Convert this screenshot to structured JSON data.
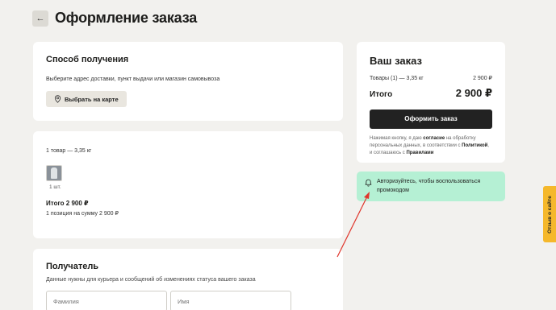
{
  "header": {
    "back_icon": "arrow-left",
    "title": "Оформление заказа"
  },
  "delivery": {
    "title": "Способ получения",
    "description": "Выберите адрес доставки, пункт выдачи или магазин самовывоза",
    "map_button": "Выбрать на карте"
  },
  "items": {
    "count_weight": "1 товар — 3,35 кг",
    "qty": "1 шт.",
    "total": "Итого 2 900 ₽",
    "summary": "1 позиция на сумму 2 900 ₽"
  },
  "recipient": {
    "title": "Получатель",
    "description": "Данные нужны для курьера и сообщений об изменениях статуса вашего заказа",
    "last_name_placeholder": "Фамилия",
    "first_name_placeholder": "Имя"
  },
  "order": {
    "title": "Ваш заказ",
    "goods_label": "Товары (1) — 3,35 кг",
    "goods_price": "2 900 ₽",
    "total_label": "Итого",
    "total_price": "2 900 ₽",
    "checkout_button": "Оформить заказ",
    "agree_1": "Нажимая кнопку, я даю ",
    "agree_consent": "согласие",
    "agree_2": " на обработку персональных данных, в соответствии с ",
    "agree_policy": "Политикой",
    "agree_3": ", и соглашаюсь с ",
    "agree_rules": "Правилами"
  },
  "promo": {
    "text": "Авторизуйтесь, чтобы воспользоваться промокодом"
  },
  "feedback": {
    "label": "Отзыв о сайте"
  },
  "colors": {
    "accent_promo": "#b5f0d4",
    "feedback_tab": "#f5b82b",
    "button_dark": "#222222",
    "arrow": "#e0352b"
  }
}
